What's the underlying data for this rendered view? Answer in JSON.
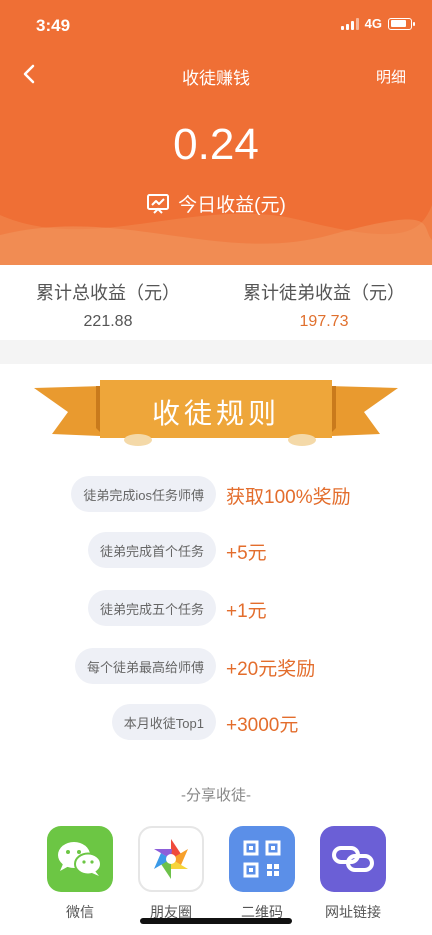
{
  "status_bar": {
    "time": "3:49",
    "network": "4G"
  },
  "nav": {
    "title": "收徒赚钱",
    "detail_label": "明细"
  },
  "today": {
    "amount": "0.24",
    "label": "今日收益(元)"
  },
  "stats": {
    "total": {
      "title": "累计总收益（元）",
      "value": "221.88"
    },
    "apprentice": {
      "title": "累计徒弟收益（元）",
      "value": "197.73"
    }
  },
  "rules": {
    "banner_title": "收徒规则",
    "items": [
      {
        "condition": "徒弟完成ios任务师傅",
        "reward": "获取100%奖励"
      },
      {
        "condition": "徒弟完成首个任务",
        "reward": "+5元"
      },
      {
        "condition": "徒弟完成五个任务",
        "reward": "+1元"
      },
      {
        "condition": "每个徒弟最高给师傅",
        "reward": "+20元奖励"
      },
      {
        "condition": "本月收徒Top1",
        "reward": "+3000元"
      }
    ]
  },
  "share": {
    "title": "-分享收徒-",
    "items": [
      {
        "label": "微信",
        "icon": "wechat-icon"
      },
      {
        "label": "朋友圈",
        "icon": "moments-icon"
      },
      {
        "label": "二维码",
        "icon": "qrcode-icon"
      },
      {
        "label": "网址链接",
        "icon": "link-icon"
      }
    ]
  },
  "colors": {
    "header": "#ef6f35",
    "reward": "#e36d2c",
    "banner": "#eea63a",
    "wechat": "#6cc644",
    "qrcode": "#5b8fe8",
    "link": "#6b5fd6"
  }
}
